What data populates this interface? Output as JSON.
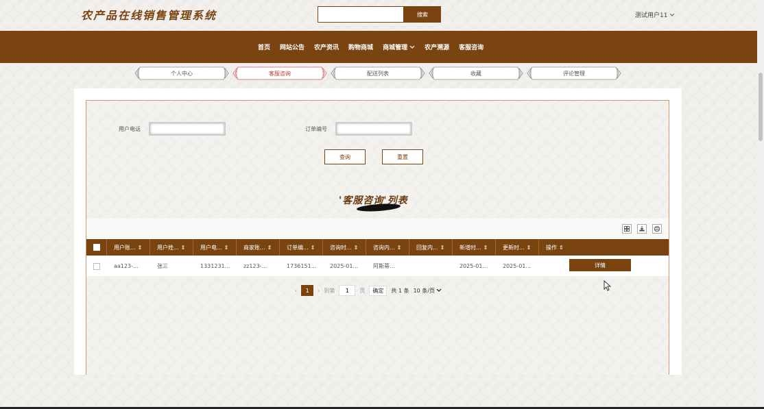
{
  "header": {
    "site_title": "农产品在线销售管理系统",
    "search_placeholder": "",
    "search_button": "搜索",
    "user_name": "测试用户11"
  },
  "nav": {
    "items": [
      {
        "label": "首页"
      },
      {
        "label": "网站公告"
      },
      {
        "label": "农产资讯"
      },
      {
        "label": "购物商城"
      },
      {
        "label": "商城管理",
        "has_dropdown": true
      },
      {
        "label": "农产溯源"
      },
      {
        "label": "客服咨询"
      }
    ]
  },
  "sub_tabs": [
    {
      "label": "个人中心",
      "active": false
    },
    {
      "label": "客服咨询",
      "active": true
    },
    {
      "label": "配送列表",
      "active": false
    },
    {
      "label": "收藏",
      "active": false
    },
    {
      "label": "评论管理",
      "active": false
    }
  ],
  "filter": {
    "phone_label": "用户电话",
    "phone_value": "",
    "order_label": "订单编号",
    "order_value": "",
    "query_button": "查询",
    "reset_button": "重置"
  },
  "list_title": "'客服咨询'列表",
  "table": {
    "columns": [
      "用户账...",
      "用户姓...",
      "用户电...",
      "商家账...",
      "订单编...",
      "咨询时...",
      "咨询内...",
      "回复内...",
      "新增时...",
      "更新时...",
      "操作"
    ],
    "rows": [
      [
        "aa123-...",
        "张三",
        "1331231...",
        "zz123-...",
        "1736151...",
        "2025-01...",
        "阿斯蒂...",
        "",
        "2025-01...",
        "2025-01..."
      ]
    ],
    "detail_button": "详情"
  },
  "pager": {
    "current_page": "1",
    "goto_label": "到第",
    "goto_value": "1",
    "page_unit": "页",
    "confirm": "确定",
    "total": "共 1 条",
    "page_size": "10 条/页"
  },
  "colors": {
    "brand": "#7a4410",
    "active_tab": "#c0392b"
  }
}
